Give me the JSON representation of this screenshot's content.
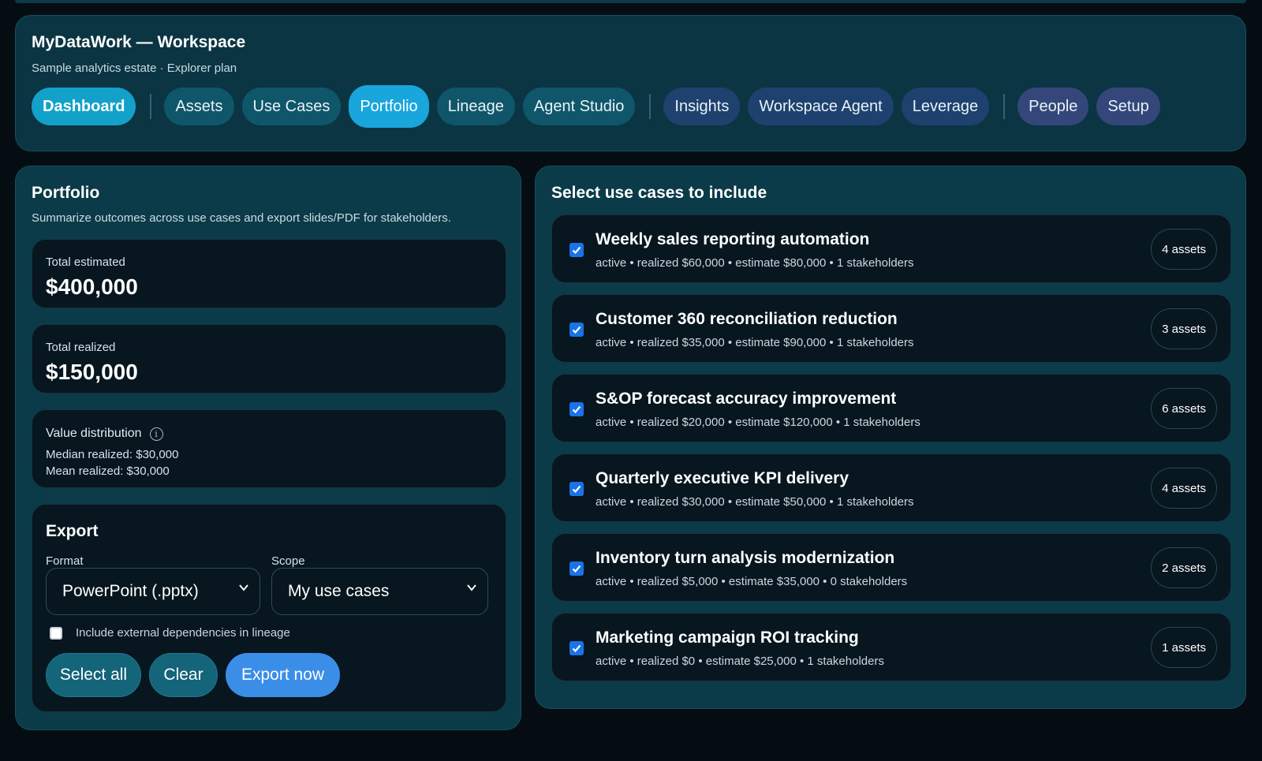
{
  "app": {
    "title": "MyDataWork — Workspace",
    "subtitle": "Sample analytics estate · Explorer plan"
  },
  "nav": {
    "dashboard": "Dashboard",
    "assets": "Assets",
    "use_cases": "Use Cases",
    "portfolio": "Portfolio",
    "lineage": "Lineage",
    "agent_studio": "Agent Studio",
    "insights": "Insights",
    "workspace_agent": "Workspace Agent",
    "leverage": "Leverage",
    "people": "People",
    "setup": "Setup"
  },
  "portfolio": {
    "title": "Portfolio",
    "description": "Summarize outcomes across use cases and export slides/PDF for stakeholders.",
    "total_estimated_label": "Total estimated",
    "total_estimated_value": "$400,000",
    "total_realized_label": "Total realized",
    "total_realized_value": "$150,000",
    "distribution_label": "Value distribution",
    "median_realized": "Median realized: $30,000",
    "mean_realized": "Mean realized: $30,000"
  },
  "export": {
    "title": "Export",
    "format_label": "Format",
    "format_value": "PowerPoint (.pptx)",
    "scope_label": "Scope",
    "scope_value": "My use cases",
    "include_external_label": "Include external dependencies in lineage",
    "include_external_checked": false,
    "select_all_label": "Select all",
    "clear_label": "Clear",
    "export_now_label": "Export now"
  },
  "use_cases": {
    "title": "Select use cases to include",
    "items": [
      {
        "name": "Weekly sales reporting automation",
        "meta": "active • realized $60,000 • estimate $80,000 • 1 stakeholders",
        "assets": "4 assets",
        "checked": true
      },
      {
        "name": "Customer 360 reconciliation reduction",
        "meta": "active • realized $35,000 • estimate $90,000 • 1 stakeholders",
        "assets": "3 assets",
        "checked": true
      },
      {
        "name": "S&OP forecast accuracy improvement",
        "meta": "active • realized $20,000 • estimate $120,000 • 1 stakeholders",
        "assets": "6 assets",
        "checked": true
      },
      {
        "name": "Quarterly executive KPI delivery",
        "meta": "active • realized $30,000 • estimate $50,000 • 1 stakeholders",
        "assets": "4 assets",
        "checked": true
      },
      {
        "name": "Inventory turn analysis modernization",
        "meta": "active • realized $5,000 • estimate $35,000 • 0 stakeholders",
        "assets": "2 assets",
        "checked": true
      },
      {
        "name": "Marketing campaign ROI tracking",
        "meta": "active • realized $0 • estimate $25,000 • 1 stakeholders",
        "assets": "1 assets",
        "checked": true
      }
    ]
  },
  "colors": {
    "background": "#060d12",
    "panel": "#0b3a48",
    "card": "#07161f",
    "accent": "#18a6dc",
    "primary_button": "#3b8ee8",
    "checkbox": "#1a73e8"
  }
}
